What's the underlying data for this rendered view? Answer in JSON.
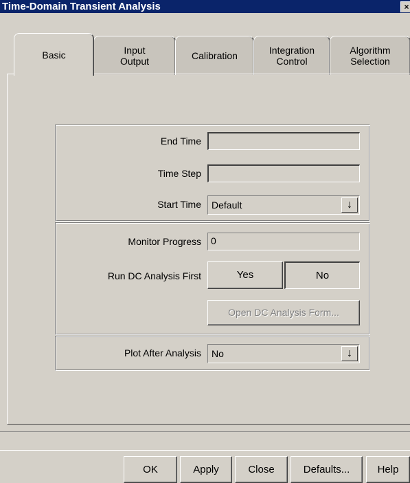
{
  "window": {
    "title": "Time-Domain Transient Analysis",
    "close_glyph": "×"
  },
  "tabs": [
    {
      "label": "Basic"
    },
    {
      "label": "Input\nOutput"
    },
    {
      "label": "Calibration"
    },
    {
      "label": "Integration\nControl"
    },
    {
      "label": "Algorithm\nSelection"
    }
  ],
  "time": {
    "end_time_label": "End Time",
    "end_time_value": "",
    "time_step_label": "Time Step",
    "time_step_value": "",
    "start_time_label": "Start Time",
    "start_time_value": "Default"
  },
  "monitor": {
    "monitor_progress_label": "Monitor Progress",
    "monitor_progress_value": "0",
    "run_dc_label": "Run DC Analysis First",
    "yes_label": "Yes",
    "no_label": "No",
    "open_dc_label": "Open DC Analysis Form..."
  },
  "plot": {
    "plot_after_label": "Plot After Analysis",
    "plot_after_value": "No"
  },
  "dropdown_glyph": "↓",
  "footer": {
    "ok_label": "OK",
    "apply_label": "Apply",
    "close_label": "Close",
    "defaults_label": "Defaults...",
    "help_label": "Help"
  },
  "colors": {
    "face": "#d4d0c8",
    "title_bar": "#0a246a"
  }
}
